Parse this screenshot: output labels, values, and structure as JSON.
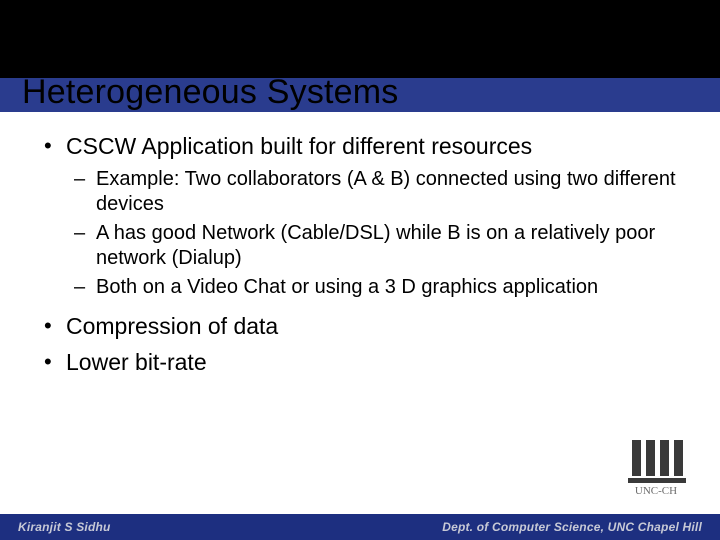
{
  "title": "Heterogeneous Systems",
  "bullets": [
    {
      "text": "CSCW Application built for different resources",
      "sub": [
        "Example: Two collaborators (A & B) connected using two different devices",
        "A has good Network (Cable/DSL) while B is on a relatively poor network (Dialup)",
        "Both on a Video Chat or using a 3 D graphics application"
      ]
    },
    {
      "text": "Compression of data",
      "sub": []
    },
    {
      "text": "Lower bit-rate",
      "sub": []
    }
  ],
  "footer": {
    "left": "Kiranjit S Sidhu",
    "right": "Dept. of Computer Science, UNC Chapel Hill"
  },
  "logo_label": "UNC-CH"
}
